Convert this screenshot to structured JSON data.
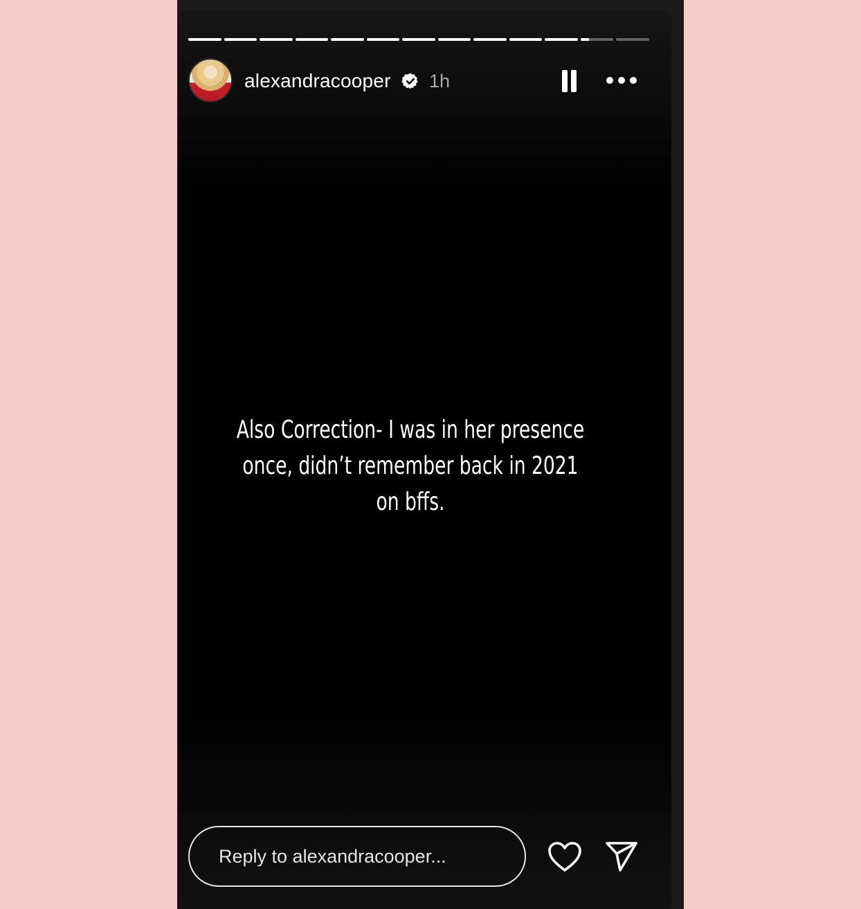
{
  "story": {
    "progress": {
      "total_segments": 13,
      "completed_segments": 11,
      "current_segment_fraction": 0.25
    },
    "author": {
      "username": "alexandracooper",
      "verified": true,
      "time_ago": "1h"
    },
    "caption_lines": [
      "Also Correction- I was in her presence",
      "once, didn’t remember back in 2021",
      "on bffs."
    ],
    "reply": {
      "placeholder": "Reply to alexandracooper..."
    },
    "icons": {
      "verified": "verified-badge-icon",
      "pause": "pause-icon",
      "more": "more-options-icon",
      "like": "heart-icon",
      "share": "send-icon"
    },
    "colors": {
      "background": "#f8cbcd",
      "story_bg": "#000000",
      "text": "#ffffff",
      "muted": "#a8a8a8"
    }
  }
}
